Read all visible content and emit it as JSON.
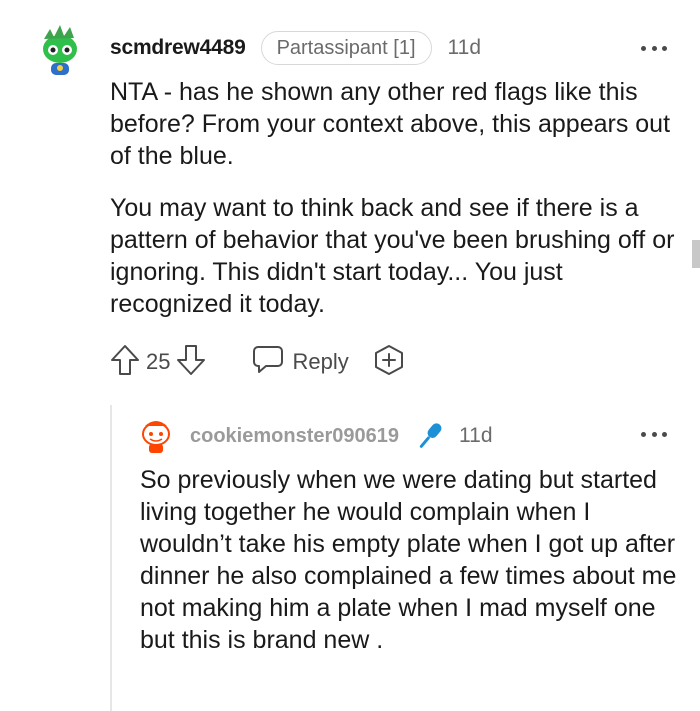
{
  "comment": {
    "username": "scmdrew4489",
    "flair": "Partassipant [1]",
    "timestamp": "11d",
    "paragraphs": [
      "NTA - has he shown any other red flags like this before? From your context above, this appears out of the blue.",
      "You may want to think back and see if there is a pattern of behavior that you've been brushing off or ignoring. This didn't start today... You just recognized it today."
    ],
    "vote_count": "25",
    "reply_label": "Reply",
    "avatar_icon": "snoo-avatar-green-icon",
    "more_icon": "more-options-icon"
  },
  "reply": {
    "username": "cookiemonster090619",
    "badge_icon": "microphone-icon",
    "badge_color": "#1e90d6",
    "timestamp": "11d",
    "text": "So previously when we were dating but started living together he would complain when I wouldn’t take his empty plate when I got up after dinner he also complained a few times about me not making him a plate when I mad myself one but this is brand new .",
    "avatar_icon": "snoo-avatar-orange-icon",
    "more_icon": "more-options-icon"
  },
  "colors": {
    "text": "#1a1a1b",
    "meta": "#6b6b6b",
    "accent_blue": "#1e90d6"
  }
}
